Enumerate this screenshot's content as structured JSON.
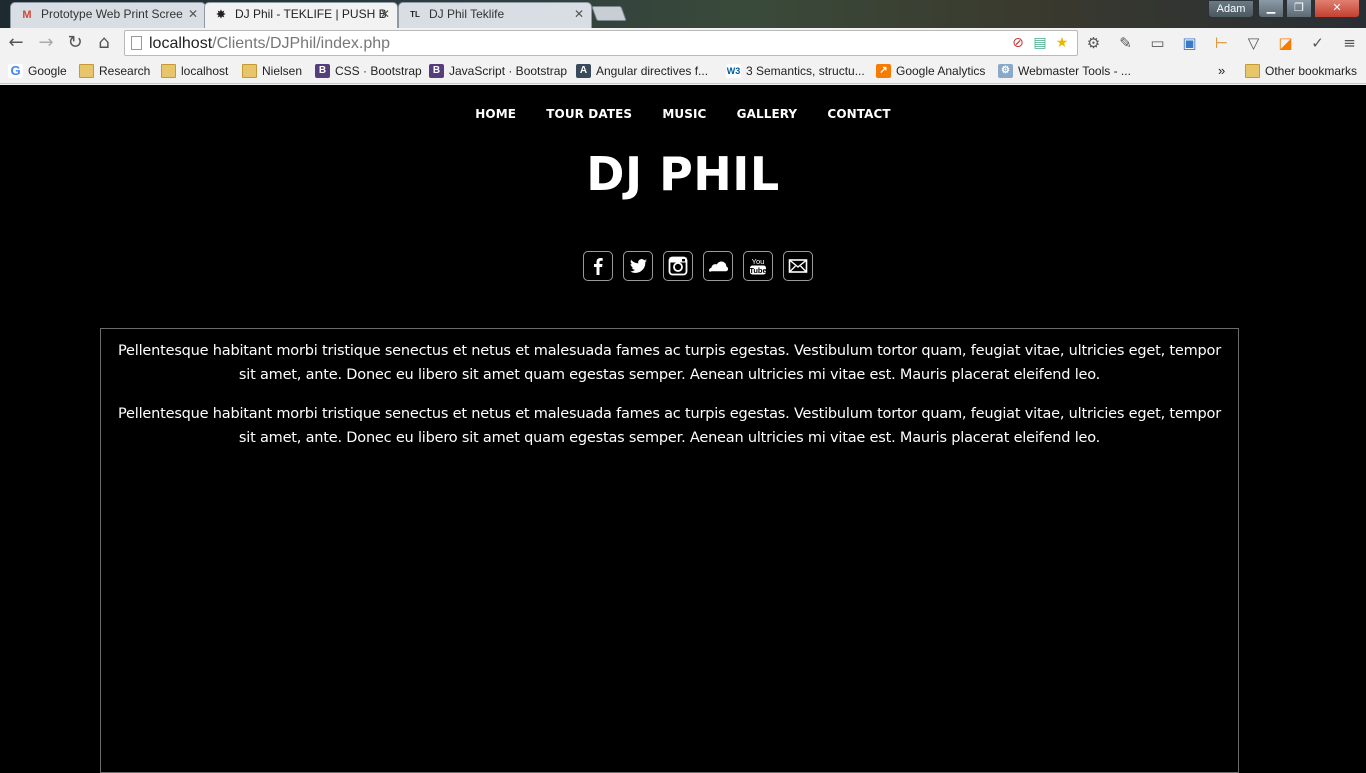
{
  "browser": {
    "tabs": [
      {
        "label": "Prototype Web Print Scree",
        "favicon": "gmail-icon",
        "active": false
      },
      {
        "label": "DJ Phil - TEKLIFE | PUSH B",
        "favicon": "soundcloud-like-icon",
        "active": true
      },
      {
        "label": "DJ Phil Teklife",
        "favicon": "teklife-icon",
        "active": false
      }
    ],
    "profile": "Adam",
    "url_host": "localhost",
    "url_path": "/Clients/DJPhil/index.php",
    "bookmarks": [
      {
        "label": "Google",
        "icon": "google-icon"
      },
      {
        "label": "Research",
        "icon": "folder-icon"
      },
      {
        "label": "localhost",
        "icon": "folder-icon"
      },
      {
        "label": "Nielsen",
        "icon": "folder-icon"
      },
      {
        "label": "CSS · Bootstrap",
        "icon": "bootstrap-icon"
      },
      {
        "label": "JavaScript · Bootstrap",
        "icon": "bootstrap-icon"
      },
      {
        "label": "Angular directives f...",
        "icon": "angular-icon"
      },
      {
        "label": "3 Semantics, structu...",
        "icon": "w3c-icon"
      },
      {
        "label": "Google Analytics",
        "icon": "analytics-icon"
      },
      {
        "label": "Webmaster Tools - ...",
        "icon": "webmaster-icon"
      }
    ],
    "bookmarks_overflow": "»",
    "other_bookmarks": "Other bookmarks"
  },
  "site": {
    "nav": [
      "HOME",
      "TOUR DATES",
      "MUSIC",
      "GALLERY",
      "CONTACT"
    ],
    "title": "DJ PHIL",
    "social": [
      "facebook-icon",
      "twitter-icon",
      "instagram-icon",
      "soundcloud-icon",
      "youtube-icon",
      "email-icon"
    ],
    "paragraphs": [
      "Pellentesque habitant morbi tristique senectus et netus et malesuada fames ac turpis egestas. Vestibulum tortor quam, feugiat vitae, ultricies eget, tempor sit amet, ante. Donec eu libero sit amet quam egestas semper. Aenean ultricies mi vitae est. Mauris placerat eleifend leo.",
      "Pellentesque habitant morbi tristique senectus et netus et malesuada fames ac turpis egestas. Vestibulum tortor quam, feugiat vitae, ultricies eget, tempor sit amet, ante. Donec eu libero sit amet quam egestas semper. Aenean ultricies mi vitae est. Mauris placerat eleifend leo."
    ]
  }
}
